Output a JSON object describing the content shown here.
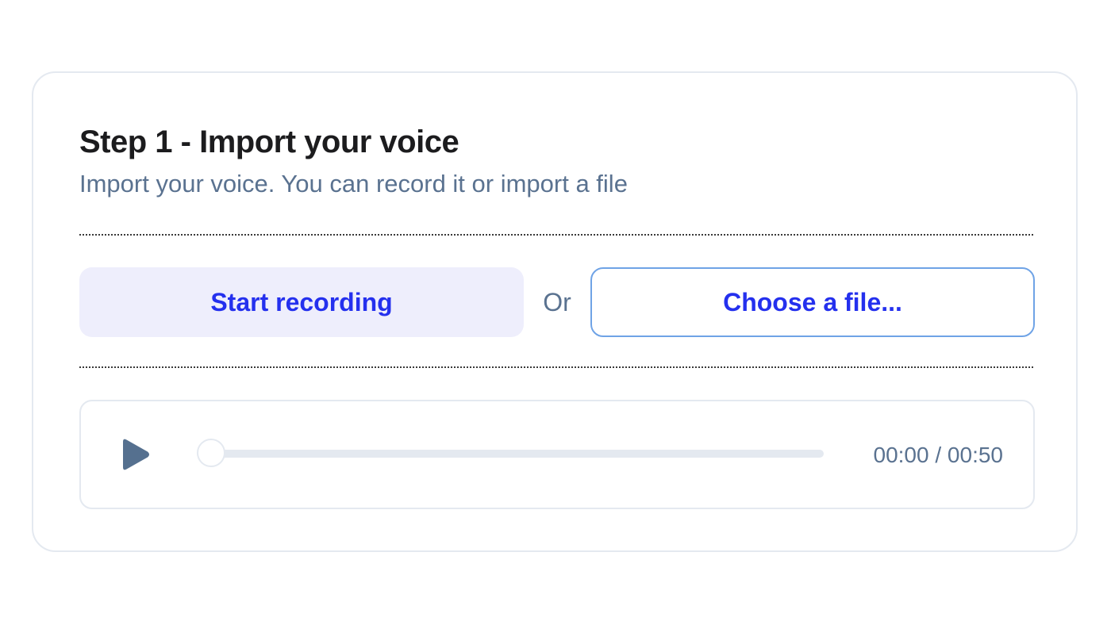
{
  "step": {
    "title": "Step 1 - Import your voice",
    "subtitle": "Import your voice. You can record it or import a file"
  },
  "actions": {
    "record_label": "Start recording",
    "separator": "Or",
    "file_label": "Choose a file..."
  },
  "player": {
    "play_icon": "play-icon",
    "progress": 0,
    "current_time": "00:00",
    "time_separator": "/",
    "duration": "00:50"
  },
  "colors": {
    "accent": "#2430ee",
    "record_bg": "#eeeefc",
    "file_border": "#6fa3e6",
    "muted_text": "#5a7290",
    "play_icon": "#55708f"
  }
}
